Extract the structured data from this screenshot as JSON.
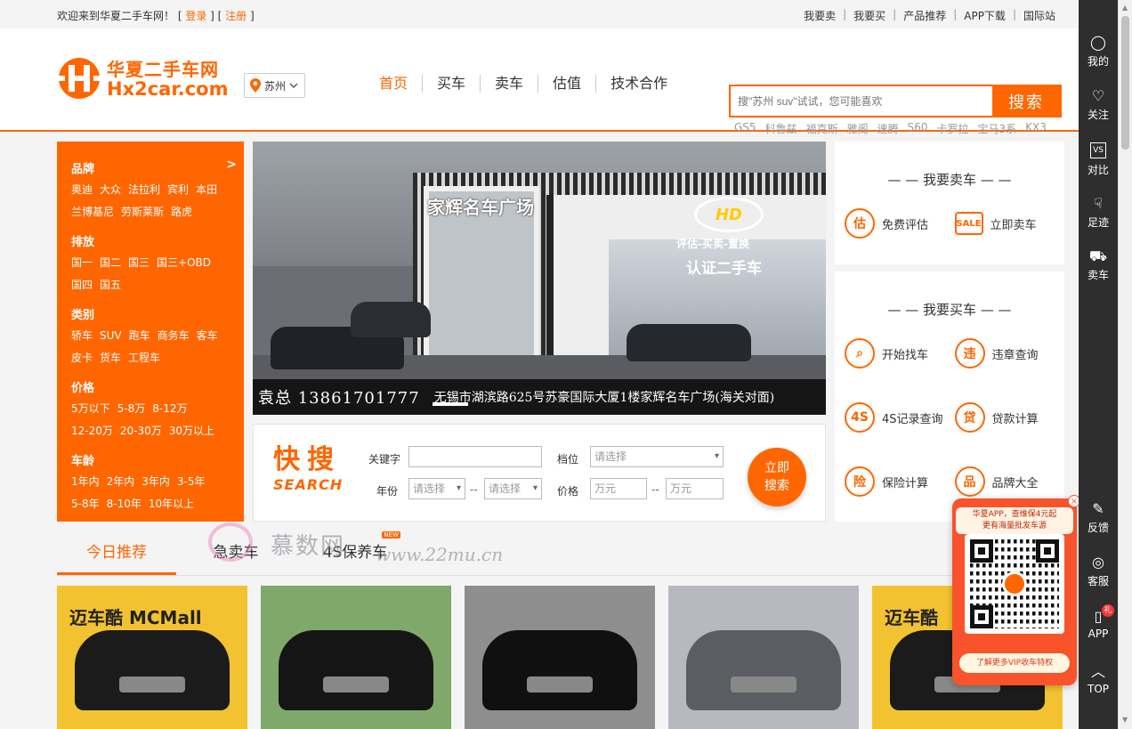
{
  "topbar": {
    "welcome": "欢迎来到华夏二手车网！",
    "login": "登录",
    "register": "注册",
    "links": [
      "我要卖",
      "我要买",
      "产品推荐",
      "APP下载",
      "国际站"
    ]
  },
  "header": {
    "logo_cn": "华夏二手车网",
    "logo_en": "Hx2car.com",
    "city": "苏州",
    "nav": [
      "首页",
      "买车",
      "卖车",
      "估值",
      "技术合作"
    ],
    "search_placeholder": "搜\"苏州 suv\"试试，您可能喜欢",
    "search_button": "搜索",
    "hotwords": [
      "GS5",
      "科鲁兹",
      "福克斯",
      "雅阁",
      "速腾",
      "S60",
      "卡罗拉",
      "宝马3系",
      "KX3"
    ]
  },
  "categories": [
    {
      "title": "品牌",
      "options": [
        "奥迪",
        "大众",
        "法拉利",
        "宾利",
        "本田",
        "兰博基尼",
        "劳斯莱斯",
        "路虎"
      ],
      "more": ">"
    },
    {
      "title": "排放",
      "options": [
        "国一",
        "国二",
        "国三",
        "国三+OBD",
        "国四",
        "国五"
      ]
    },
    {
      "title": "类别",
      "options": [
        "轿车",
        "SUV",
        "跑车",
        "商务车",
        "客车",
        "皮卡",
        "货车",
        "工程车"
      ]
    },
    {
      "title": "价格",
      "options": [
        "5万以下",
        "5-8万",
        "8-12万",
        "12-20万",
        "20-30万",
        "30万以上"
      ]
    },
    {
      "title": "车龄",
      "options": [
        "1年内",
        "2年内",
        "3年内",
        "3-5年",
        "5-8年",
        "8-10年",
        "10年以上"
      ]
    }
  ],
  "banner": {
    "sign_main": "家辉名车广场",
    "sign_sub": "认证二手车",
    "sign_tagline": "评估-买卖-置换",
    "logo_text": "HD",
    "caption_contact": "袁总 13861701777",
    "caption_address": "无锡市湖滨路625号苏豪国际大厦1楼家辉名车广场(海关对面)"
  },
  "quick_search": {
    "logo_big": "快搜",
    "logo_small": "SEARCH",
    "keyword_label": "关键字",
    "keyword_value": "",
    "gear_label": "档位",
    "gear_placeholder": "请选择",
    "year_label": "年份",
    "year_from": "请选择",
    "year_to": "请选择",
    "price_label": "价格",
    "price_from": "万元",
    "price_to": "万元",
    "range_sep": "--",
    "button": "立即\n搜索"
  },
  "sell_panel": {
    "title": "— — 我要卖车 — —",
    "items": [
      {
        "label": "免费评估",
        "icon": "car-estimate-icon",
        "glyph": "估"
      },
      {
        "label": "立即卖车",
        "icon": "sale-tag-icon",
        "glyph": "SALE"
      }
    ]
  },
  "buy_panel": {
    "title": "— — 我要买车 — —",
    "items": [
      {
        "label": "开始找车",
        "icon": "search-car-icon",
        "glyph": "⌕"
      },
      {
        "label": "违章查询",
        "icon": "violation-icon",
        "glyph": "违"
      },
      {
        "label": "4S记录查询",
        "icon": "4s-record-icon",
        "glyph": "4S"
      },
      {
        "label": "贷款计算",
        "icon": "loan-icon",
        "glyph": "贷"
      },
      {
        "label": "保险计算",
        "icon": "insurance-icon",
        "glyph": "险"
      },
      {
        "label": "品牌大全",
        "icon": "brand-icon",
        "glyph": "品"
      }
    ]
  },
  "tabs": [
    {
      "label": "今日推荐",
      "active": true
    },
    {
      "label": "急卖车",
      "active": false
    },
    {
      "label": "4S保养车",
      "active": false,
      "badge": "NEW"
    }
  ],
  "cards": [
    {
      "name": "alphard-mpv",
      "bg": "#f2c230",
      "body": "#1b1b1b",
      "sign": "迈车酷 MCMall"
    },
    {
      "name": "bmw-7-series",
      "bg": "#7fa86a",
      "body": "#151515",
      "sign": ""
    },
    {
      "name": "toyota-camry",
      "bg": "#8e8e8e",
      "body": "#101010",
      "sign": ""
    },
    {
      "name": "vw-jetta",
      "bg": "#b8b8c0",
      "body": "#5a5e63",
      "sign": ""
    },
    {
      "name": "lexus-lm",
      "bg": "#f2c230",
      "body": "#1b1b1b",
      "sign": "迈车酷"
    }
  ],
  "watermark": {
    "text": "慕数网",
    "url": "www.22mu.cn"
  },
  "sidebar": [
    {
      "label": "我的",
      "icon": "user-icon",
      "glyph": "◯"
    },
    {
      "label": "关注",
      "icon": "heart-icon",
      "glyph": "♡"
    },
    {
      "label": "对比",
      "icon": "compare-icon",
      "glyph": "VS"
    },
    {
      "label": "足迹",
      "icon": "footprint-icon",
      "glyph": "☟"
    },
    {
      "label": "卖车",
      "icon": "car-icon",
      "glyph": "⛟"
    },
    {
      "label": "反馈",
      "icon": "feedback-icon",
      "glyph": "✎"
    },
    {
      "label": "客服",
      "icon": "service-icon",
      "glyph": "◎"
    },
    {
      "label": "APP",
      "icon": "phone-icon",
      "glyph": "▯",
      "badge": "礼"
    },
    {
      "label": "TOP",
      "icon": "arrow-up-icon",
      "glyph": "︿"
    }
  ],
  "qr_popup": {
    "head": "华夏APP，查维保4元起\n更有海量批发车源",
    "footer": "了解更多VIP收车特权",
    "close": "×"
  }
}
